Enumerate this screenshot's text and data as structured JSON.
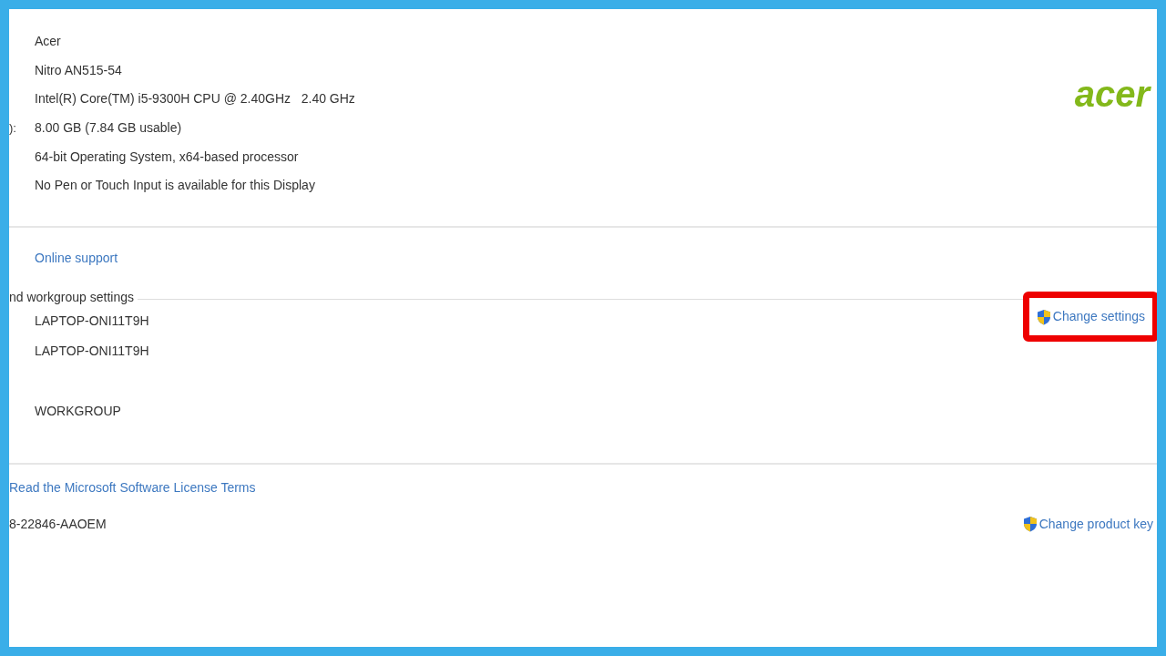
{
  "system": {
    "values": [
      {
        "value": "Acer"
      },
      {
        "value": "Nitro AN515-54"
      },
      {
        "value": "Intel(R) Core(TM) i5-9300H CPU @ 2.40GHz   2.40 GHz"
      },
      {
        "label": "):",
        "value": "8.00 GB (7.84 GB usable)"
      },
      {
        "value": "64-bit Operating System, x64-based processor"
      },
      {
        "value": "No Pen or Touch Input is available for this Display"
      }
    ],
    "logo": "acer"
  },
  "support": {
    "link": "Online support"
  },
  "computer_name": {
    "heading": "nd workgroup settings",
    "values": [
      {
        "kind": "line",
        "value": "LAPTOP-ONI11T9H"
      },
      {
        "kind": "line",
        "value": "LAPTOP-ONI11T9H"
      },
      {
        "kind": "spaced",
        "value": "WORKGROUP"
      }
    ],
    "action": {
      "label": "Change settings",
      "highlighted": true
    }
  },
  "activation": {
    "link": "Read the Microsoft Software License Terms",
    "product_id": "8-22846-AAOEM",
    "action": {
      "label": "Change product key",
      "highlighted": false
    }
  }
}
